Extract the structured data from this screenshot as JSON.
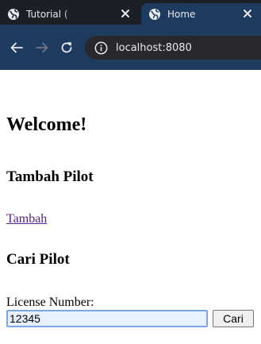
{
  "browser": {
    "tabs": [
      {
        "title": "Tutorial (",
        "favicon": "globe-icon",
        "active": false
      },
      {
        "title": "Home",
        "favicon": "globe-icon",
        "active": true
      }
    ],
    "address_bar": {
      "url": "localhost:8080"
    },
    "colors": {
      "tabstrip": "#1d1f27",
      "toolbar": "#1e3a5f",
      "omnibox": "#28282c",
      "link_visited": "#551a8b"
    }
  },
  "page": {
    "heading": "Welcome!",
    "add_section": {
      "title": "Tambah Pilot",
      "link_text": "Tambah"
    },
    "search_section": {
      "title": "Cari Pilot",
      "field_label": "License Number:",
      "field_value": "12345",
      "button_label": "Cari"
    }
  }
}
